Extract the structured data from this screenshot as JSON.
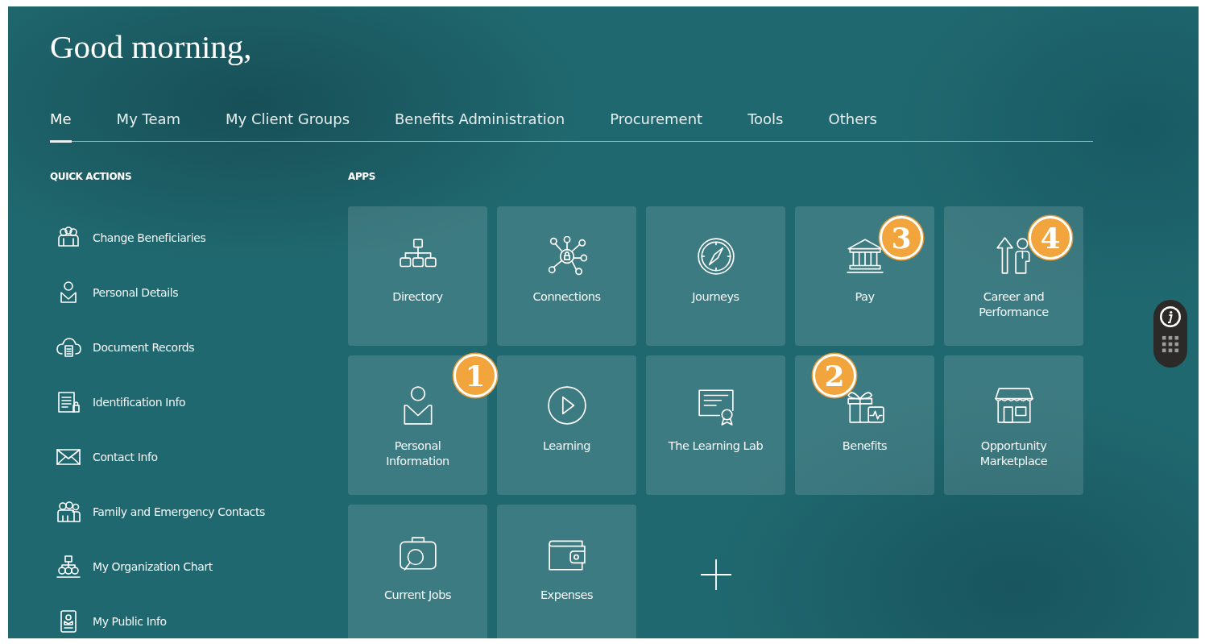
{
  "greeting": "Good morning,",
  "tabs": [
    {
      "label": "Me",
      "selected": true
    },
    {
      "label": "My Team",
      "selected": false
    },
    {
      "label": "My Client Groups",
      "selected": false
    },
    {
      "label": "Benefits Administration",
      "selected": false
    },
    {
      "label": "Procurement",
      "selected": false
    },
    {
      "label": "Tools",
      "selected": false
    },
    {
      "label": "Others",
      "selected": false
    }
  ],
  "quick_actions": {
    "title": "QUICK ACTIONS",
    "items": [
      {
        "label": "Change Beneficiaries"
      },
      {
        "label": "Personal Details"
      },
      {
        "label": "Document Records"
      },
      {
        "label": "Identification Info"
      },
      {
        "label": "Contact Info"
      },
      {
        "label": "Family and Emergency Contacts"
      },
      {
        "label": "My Organization Chart"
      },
      {
        "label": "My Public Info"
      }
    ]
  },
  "apps": {
    "title": "APPS",
    "tiles": [
      {
        "kind": "app",
        "label": "Directory"
      },
      {
        "kind": "app",
        "label": "Connections"
      },
      {
        "kind": "app",
        "label": "Journeys"
      },
      {
        "kind": "app",
        "label": "Pay",
        "callout": "3"
      },
      {
        "kind": "app",
        "label": "Career and Performance",
        "callout": "4"
      },
      {
        "kind": "app",
        "label": "Personal Information",
        "callout": "1"
      },
      {
        "kind": "app",
        "label": "Learning"
      },
      {
        "kind": "app",
        "label": "The Learning Lab"
      },
      {
        "kind": "app",
        "label": "Benefits",
        "callout": "2"
      },
      {
        "kind": "app",
        "label": "Opportunity Marketplace"
      },
      {
        "kind": "app",
        "label": "Current Jobs"
      },
      {
        "kind": "app",
        "label": "Expenses"
      },
      {
        "kind": "add"
      }
    ]
  }
}
